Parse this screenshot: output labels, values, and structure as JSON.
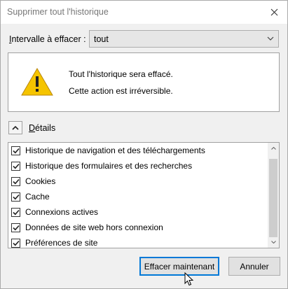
{
  "window": {
    "title": "Supprimer tout l'historique"
  },
  "range": {
    "label_prefix": "I",
    "label_rest": "ntervalle à effacer :",
    "selected": "tout"
  },
  "warning": {
    "line1": "Tout l'historique sera effacé.",
    "line2": "Cette action est irréversible."
  },
  "details": {
    "label_prefix": "D",
    "label_rest": "étails",
    "expanded": true
  },
  "items": [
    {
      "label": "Historique de navigation et des téléchargements",
      "checked": true
    },
    {
      "label": "Historique des formulaires et des recherches",
      "checked": true
    },
    {
      "label": "Cookies",
      "checked": true
    },
    {
      "label": "Cache",
      "checked": true
    },
    {
      "label": "Connexions actives",
      "checked": true
    },
    {
      "label": "Données de site web hors connexion",
      "checked": true
    },
    {
      "label": "Préférences de site",
      "checked": true
    }
  ],
  "buttons": {
    "primary": "Effacer maintenant",
    "cancel": "Annuler"
  },
  "colors": {
    "accent": "#0078d7",
    "warning": "#f5c400"
  },
  "icons": [
    "close-icon",
    "chevron-down-icon",
    "warning-icon",
    "chevron-up-icon",
    "checkmark-icon",
    "scroll-up-arrow-icon",
    "scroll-down-arrow-icon",
    "mouse-cursor-icon"
  ]
}
